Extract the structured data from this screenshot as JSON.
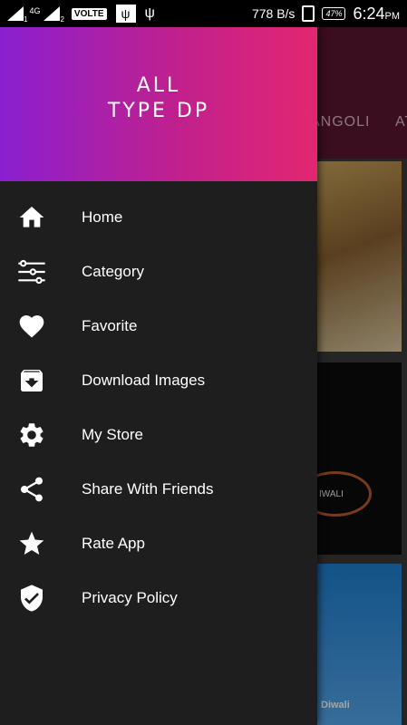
{
  "status_bar": {
    "sim1": "1",
    "net": "4G",
    "sim2": "2",
    "volte": "VOLTE",
    "speed": "778 B/s",
    "battery": "47%",
    "time": "6:24",
    "ampm": "PM"
  },
  "background": {
    "tab_partial_1": "ANGOLI",
    "tab_partial_2": "AT",
    "card_text": "IWALI",
    "card3_text": "Diwali"
  },
  "drawer": {
    "title_line1": "ALL",
    "title_line2": "TYPE DP",
    "items": [
      {
        "label": "Home",
        "icon": "home-icon"
      },
      {
        "label": "Category",
        "icon": "sliders-icon"
      },
      {
        "label": "Favorite",
        "icon": "heart-icon"
      },
      {
        "label": "Download Images",
        "icon": "download-icon"
      },
      {
        "label": "My Store",
        "icon": "gear-icon"
      },
      {
        "label": "Share With Friends",
        "icon": "share-icon"
      },
      {
        "label": "Rate App",
        "icon": "star-icon"
      },
      {
        "label": "Privacy Policy",
        "icon": "shield-icon"
      }
    ]
  },
  "colors": {
    "header_start": "#8a1fd0",
    "header_end": "#e32670",
    "drawer_bg": "#1e1e1e"
  }
}
